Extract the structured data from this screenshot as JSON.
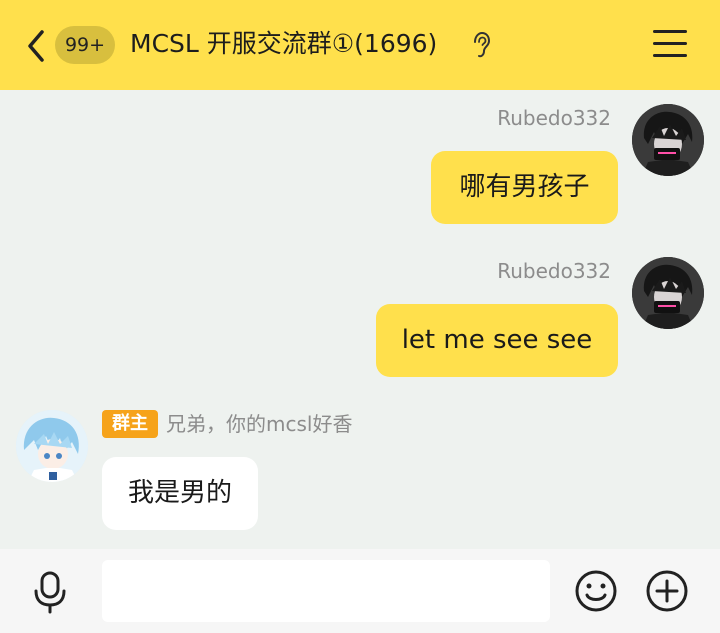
{
  "header": {
    "unread_count": "99+",
    "title": "MCSL 开服交流群①(1696)",
    "icons": {
      "back": "chevron-left-icon",
      "ear": "ear-icon",
      "menu": "hamburger-menu-icon"
    }
  },
  "messages": [
    {
      "sender": "Rubedo332",
      "text": "哪有男孩子",
      "side": "right"
    },
    {
      "sender": "Rubedo332",
      "text": "let me see see",
      "side": "right"
    },
    {
      "sender": "兄弟，你的mcsl好香",
      "role": "群主",
      "text": "我是男的",
      "side": "left"
    }
  ],
  "composer": {
    "input_value": "",
    "icons": {
      "voice": "microphone-icon",
      "emoji": "smiley-face-icon",
      "more": "plus-circle-icon"
    }
  },
  "colors": {
    "accent": "#ffe04c",
    "background": "#eef2ef",
    "role_badge": "#f6a31a"
  }
}
